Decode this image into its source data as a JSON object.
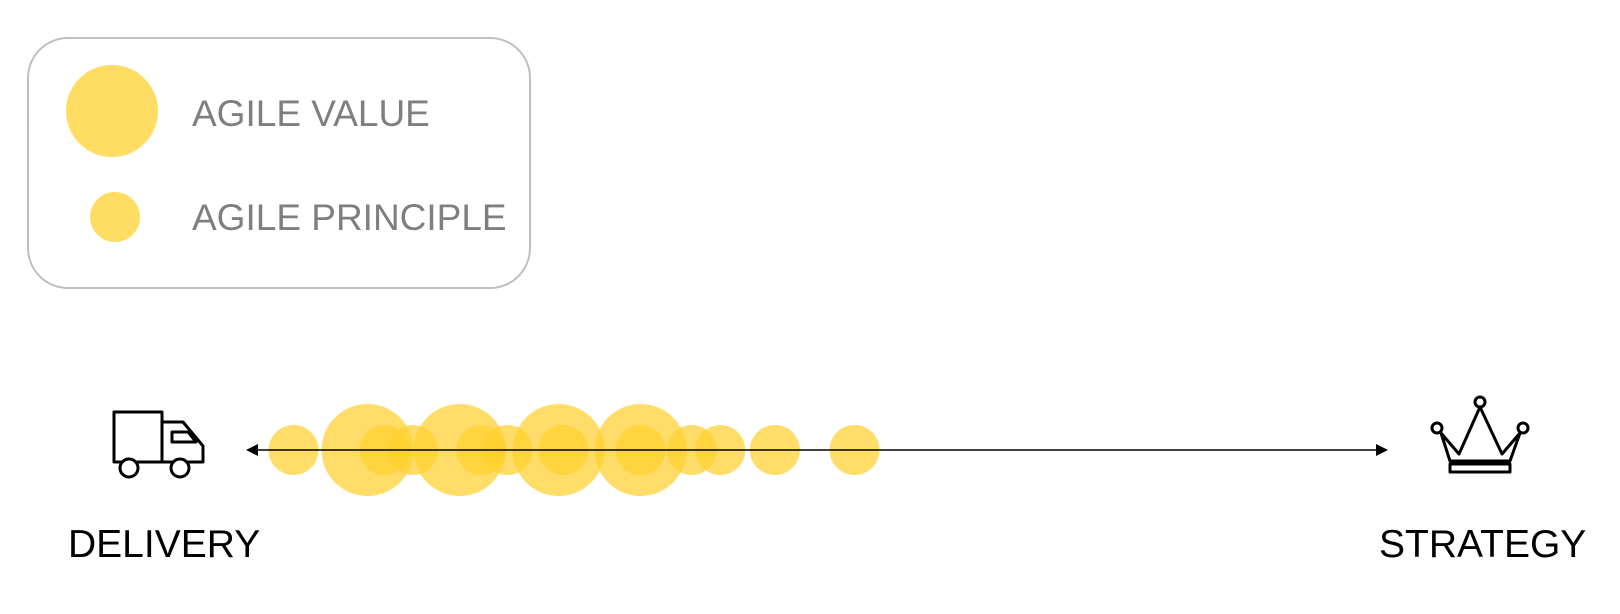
{
  "legend": {
    "value_label": "AGILE VALUE",
    "principle_label": "AGILE PRINCIPLE"
  },
  "axis": {
    "left_label": "DELIVERY",
    "right_label": "STRATEGY",
    "left_icon": "delivery-truck-icon",
    "right_icon": "crown-icon"
  },
  "colors": {
    "bubble": "#ffd02e",
    "legend_border": "#bfbfbf",
    "legend_text": "#7f7f7f"
  },
  "bubbles": [
    {
      "kind": "principle",
      "pos": 0.04
    },
    {
      "kind": "value",
      "pos": 0.105
    },
    {
      "kind": "principle",
      "pos": 0.12
    },
    {
      "kind": "principle",
      "pos": 0.145
    },
    {
      "kind": "value",
      "pos": 0.186
    },
    {
      "kind": "principle",
      "pos": 0.205
    },
    {
      "kind": "principle",
      "pos": 0.228
    },
    {
      "kind": "value",
      "pos": 0.273
    },
    {
      "kind": "principle",
      "pos": 0.277
    },
    {
      "kind": "value",
      "pos": 0.345
    },
    {
      "kind": "principle",
      "pos": 0.345
    },
    {
      "kind": "principle",
      "pos": 0.39
    },
    {
      "kind": "principle",
      "pos": 0.415
    },
    {
      "kind": "principle",
      "pos": 0.463
    },
    {
      "kind": "principle",
      "pos": 0.533
    }
  ]
}
